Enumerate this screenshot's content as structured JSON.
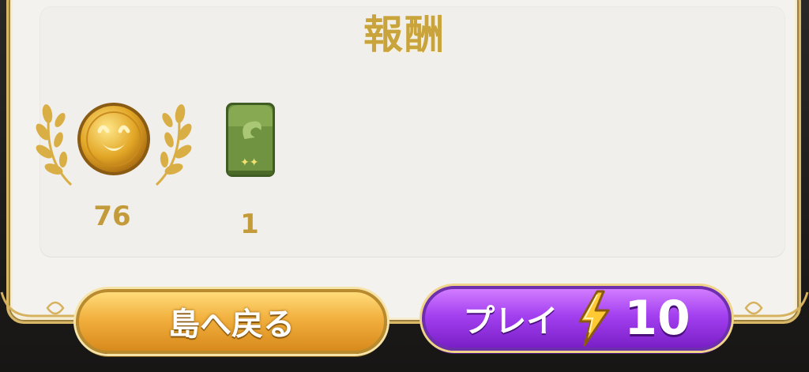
{
  "header": {
    "title": "報酬"
  },
  "rewards": [
    {
      "name": "coin",
      "count": "76"
    },
    {
      "name": "card-pack",
      "count": "1"
    }
  ],
  "buttons": {
    "home_label": "島へ戻る",
    "play_label": "プレイ",
    "energy_cost": "10"
  },
  "colors": {
    "gold_text": "#c9a33b",
    "home_button": "#f2b03e",
    "play_button": "#a340f0",
    "panel_background": "#f4f2ef"
  },
  "icons": [
    "laurel-wreath-icon",
    "gold-coin-icon",
    "green-card-pack-icon",
    "lightning-bolt-icon"
  ]
}
